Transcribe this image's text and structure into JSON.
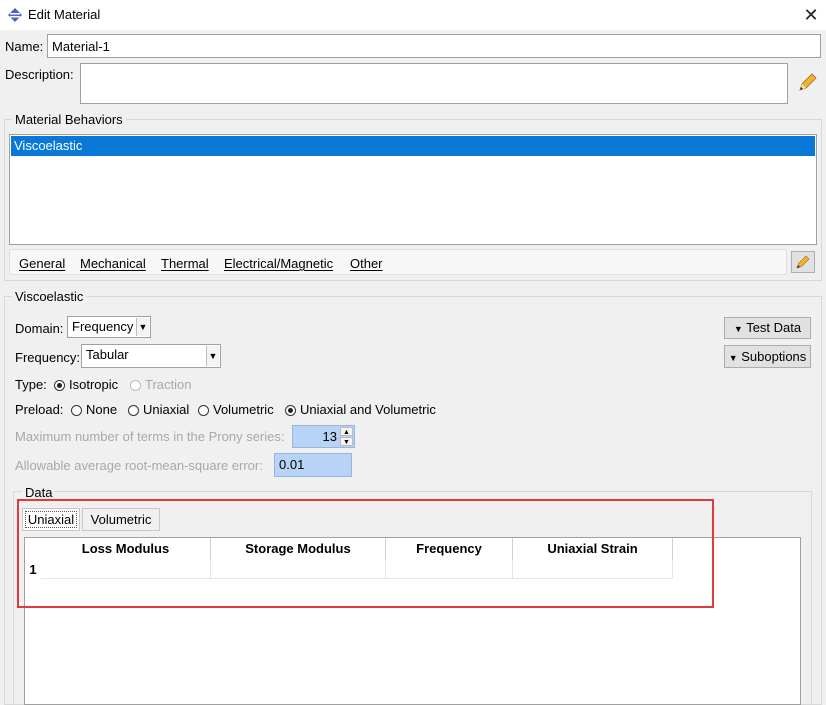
{
  "window": {
    "title": "Edit Material",
    "close_glyph": "✕",
    "app_icon": "abaqus-diamond-icon"
  },
  "form": {
    "name_label": "Name:",
    "name_value": "Material-1",
    "description_label": "Description:",
    "description_value": ""
  },
  "behaviors": {
    "group_title": "Material Behaviors",
    "items": [
      "Viscoelastic"
    ],
    "selected_index": 0,
    "menu": [
      "General",
      "Mechanical",
      "Thermal",
      "Electrical/Magnetic",
      "Other"
    ]
  },
  "viscoelastic": {
    "group_title": "Viscoelastic",
    "domain_label": "Domain:",
    "domain_value": "Frequency",
    "frequency_label": "Frequency:",
    "frequency_value": "Tabular",
    "type_label": "Type:",
    "type_options": [
      "Isotropic",
      "Traction"
    ],
    "preload_label": "Preload:",
    "preload_options": [
      "None",
      "Uniaxial",
      "Volumetric",
      "Uniaxial and Volumetric"
    ],
    "prony_label": "Maximum number of terms in the Prony series:",
    "prony_value": "13",
    "rms_label": "Allowable average root-mean-square error:",
    "rms_value": "0.01",
    "test_data_button": "Test Data",
    "suboptions_button": "Suboptions"
  },
  "data": {
    "group_title": "Data",
    "tabs": [
      "Uniaxial",
      "Volumetric"
    ],
    "active_tab": 0,
    "columns": [
      "Loss Modulus",
      "Storage Modulus",
      "Frequency",
      "Uniaxial Strain"
    ],
    "rows": [
      [
        "",
        "",
        "",
        ""
      ]
    ],
    "row_numbers": [
      "1"
    ]
  },
  "colors": {
    "selection": "#0a78d7",
    "highlight_box": "#e0393e",
    "blue_field": "#b7d3f5"
  }
}
